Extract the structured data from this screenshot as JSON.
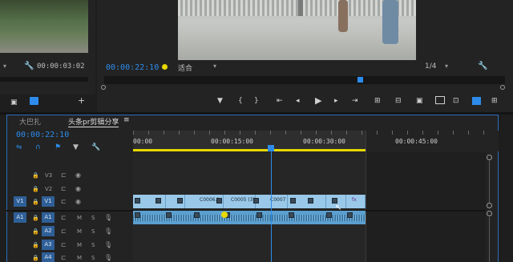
{
  "source_monitor": {
    "timecode": "00:00:03:02"
  },
  "program_monitor": {
    "timecode": "00:00:22:10",
    "fit_label": "适合",
    "resolution": "1/4"
  },
  "timeline": {
    "tabs": [
      {
        "label": "大巴扎"
      },
      {
        "label": "头条pr剪辑分享"
      }
    ],
    "menu_glyph": "≡",
    "timecode": "00:00:22:10",
    "ruler": [
      "00:00",
      "00:00:15:00",
      "00:00:30:00",
      "00:00:45:00"
    ],
    "video_tracks": [
      {
        "name": "V3",
        "source": ""
      },
      {
        "name": "V2",
        "source": ""
      },
      {
        "name": "V1",
        "source": "V1"
      }
    ],
    "audio_tracks": [
      {
        "name": "A1",
        "source": "A1",
        "m": "M",
        "s": "S"
      },
      {
        "name": "A2",
        "source": "",
        "m": "M",
        "s": "S"
      },
      {
        "name": "A3",
        "source": "",
        "m": "M",
        "s": "S"
      },
      {
        "name": "A4",
        "source": "",
        "m": "M",
        "s": "S"
      }
    ],
    "clip_labels": [
      "C0006.(",
      "C0005 (3).",
      "C0007",
      "fx"
    ]
  },
  "colors": {
    "accent": "#2d8ceb",
    "clip_video": "#99c8e8",
    "clip_audio": "#5b9fcf",
    "playhead": "#2d8ceb",
    "work_area": "#e8d800"
  }
}
